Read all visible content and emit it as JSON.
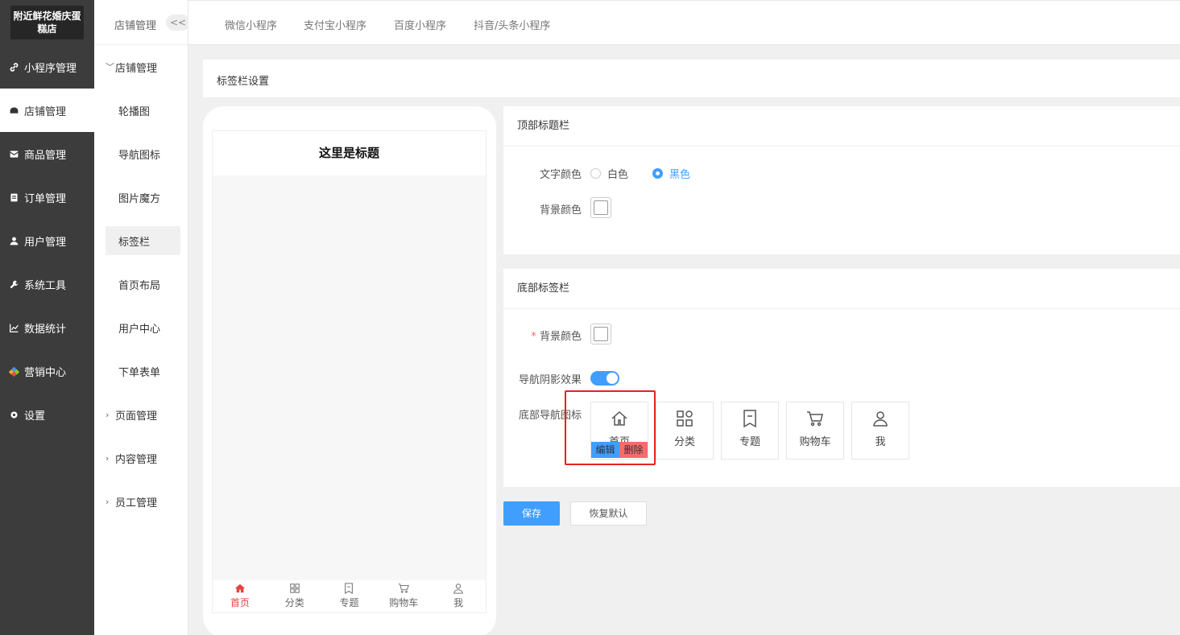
{
  "shop_name": "附近鲜花婚庆蛋糕店",
  "sidebar": {
    "items": [
      {
        "label": "小程序管理",
        "icon": "link-icon"
      },
      {
        "label": "店铺管理",
        "icon": "shop-icon",
        "active": true
      },
      {
        "label": "商品管理",
        "icon": "box-icon"
      },
      {
        "label": "订单管理",
        "icon": "order-icon"
      },
      {
        "label": "用户管理",
        "icon": "user-icon"
      },
      {
        "label": "系统工具",
        "icon": "wrench-icon"
      },
      {
        "label": "数据统计",
        "icon": "chart-icon"
      },
      {
        "label": "营销中心",
        "icon": "marketing-icon"
      },
      {
        "label": "设置",
        "icon": "settings-icon"
      }
    ]
  },
  "subnav": {
    "title": "店铺管理",
    "collapse_label": "<<",
    "group_open": "店铺管理",
    "children": [
      "轮播图",
      "导航图标",
      "图片魔方",
      "标签栏",
      "首页布局",
      "用户中心",
      "下单表单"
    ],
    "active_child": "标签栏",
    "groups_closed": [
      "页面管理",
      "内容管理",
      "员工管理"
    ]
  },
  "top_tabs": [
    "微信小程序",
    "支付宝小程序",
    "百度小程序",
    "抖音/头条小程序"
  ],
  "panel_title": "标签栏设置",
  "phone": {
    "header_title": "这里是标题",
    "tabbar": [
      {
        "label": "首页",
        "icon": "home-icon",
        "active": true
      },
      {
        "label": "分类",
        "icon": "category-icon"
      },
      {
        "label": "专题",
        "icon": "bookmark-icon"
      },
      {
        "label": "购物车",
        "icon": "cart-icon"
      },
      {
        "label": "我",
        "icon": "person-icon"
      }
    ],
    "active_color": "#e64340"
  },
  "top_bar_card": {
    "title": "顶部标题栏",
    "text_color_label": "文字颜色",
    "text_color_options": [
      "白色",
      "黑色"
    ],
    "text_color_selected": "黑色",
    "bg_color_label": "背景颜色"
  },
  "bottom_bar_card": {
    "title": "底部标签栏",
    "required_mark": "*",
    "bg_color_label": "背景颜色",
    "shadow_label": "导航阴影效果",
    "shadow_on": true,
    "icons_label": "底部导航图标",
    "icons": [
      {
        "label": "首页",
        "icon": "home-icon"
      },
      {
        "label": "分类",
        "icon": "category-icon"
      },
      {
        "label": "专题",
        "icon": "bookmark-icon"
      },
      {
        "label": "购物车",
        "icon": "cart-icon"
      },
      {
        "label": "我",
        "icon": "person-icon"
      }
    ],
    "edit_label": "编辑",
    "delete_label": "删除"
  },
  "buttons": {
    "save": "保存",
    "reset": "恢复默认"
  },
  "colors": {
    "sidebar_bg": "#3c3c3c",
    "primary": "#409eff",
    "danger": "#f56c6c",
    "highlight": "#e52222"
  }
}
